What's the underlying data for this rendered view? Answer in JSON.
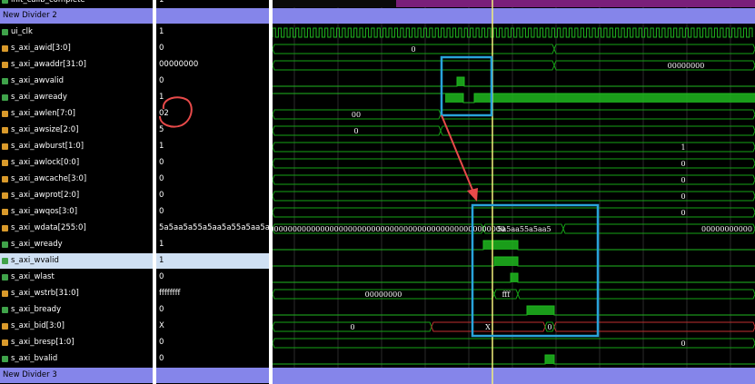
{
  "names": {
    "top_partial": "init_calib_complete",
    "divider_top": "New Divider 2",
    "divider_bottom": "New Divider 3",
    "signals": [
      "ui_clk",
      "s_axi_awid[3:0]",
      "s_axi_awaddr[31:0]",
      "s_axi_awvalid",
      "s_axi_awready",
      "s_axi_awlen[7:0]",
      "s_axi_awsize[2:0]",
      "s_axi_awburst[1:0]",
      "s_axi_awlock[0:0]",
      "s_axi_awcache[3:0]",
      "s_axi_awprot[2:0]",
      "s_axi_awqos[3:0]",
      "s_axi_wdata[255:0]",
      "s_axi_wready",
      "s_axi_wvalid",
      "s_axi_wlast",
      "s_axi_wstrb[31:0]",
      "s_axi_bready",
      "s_axi_bid[3:0]",
      "s_axi_bresp[1:0]",
      "s_axi_bvalid"
    ],
    "icons": [
      "bit-signal-icon",
      "bus-signal-icon",
      "bus-signal-icon",
      "bit-signal-icon",
      "bit-signal-icon",
      "bus-signal-icon",
      "bus-signal-icon",
      "bus-signal-icon",
      "bus-signal-icon",
      "bus-signal-icon",
      "bus-signal-icon",
      "bus-signal-icon",
      "bus-signal-icon",
      "bit-signal-icon",
      "bit-signal-icon",
      "bit-signal-icon",
      "bus-signal-icon",
      "bit-signal-icon",
      "bus-signal-icon",
      "bus-signal-icon",
      "bit-signal-icon"
    ]
  },
  "values": {
    "top_partial": "1",
    "signals": [
      "1",
      "0",
      "00000000",
      "0",
      "1",
      "02",
      "5",
      "1",
      "0",
      "0",
      "0",
      "0",
      "5a5aa5a55a5aa5a55a5aa5a55",
      "1",
      "1",
      "0",
      "ffffffff",
      "0",
      "X",
      "0",
      "0"
    ]
  },
  "wave_labels": {
    "awid": "0",
    "awaddr": "00000000",
    "awlen": "00",
    "awsize": "0",
    "awburst": "1",
    "awlock": "0",
    "awcache": "0",
    "awprot": "0",
    "awqos": "0",
    "wdata_left": "0000000000000000000000000000000000000000000000000000000",
    "wdata_mid": "5a5aa55a5aa5",
    "wdata_right": "00000000000",
    "wstrb_left": "00000000",
    "wstrb_mid": "fff",
    "bid_left": "0",
    "bid_x": "X",
    "bid_right": "0",
    "bresp": "0"
  },
  "colors": {
    "signal_green": "#1fb81f",
    "bus_green": "#16a316",
    "highlight_box": "#29a3db",
    "cursor": "#f2f07a",
    "divider": "#8585ea",
    "annotation_red": "#e84a4a",
    "x_state_red": "#c03030",
    "calib_purple": "#7a1f7a"
  }
}
